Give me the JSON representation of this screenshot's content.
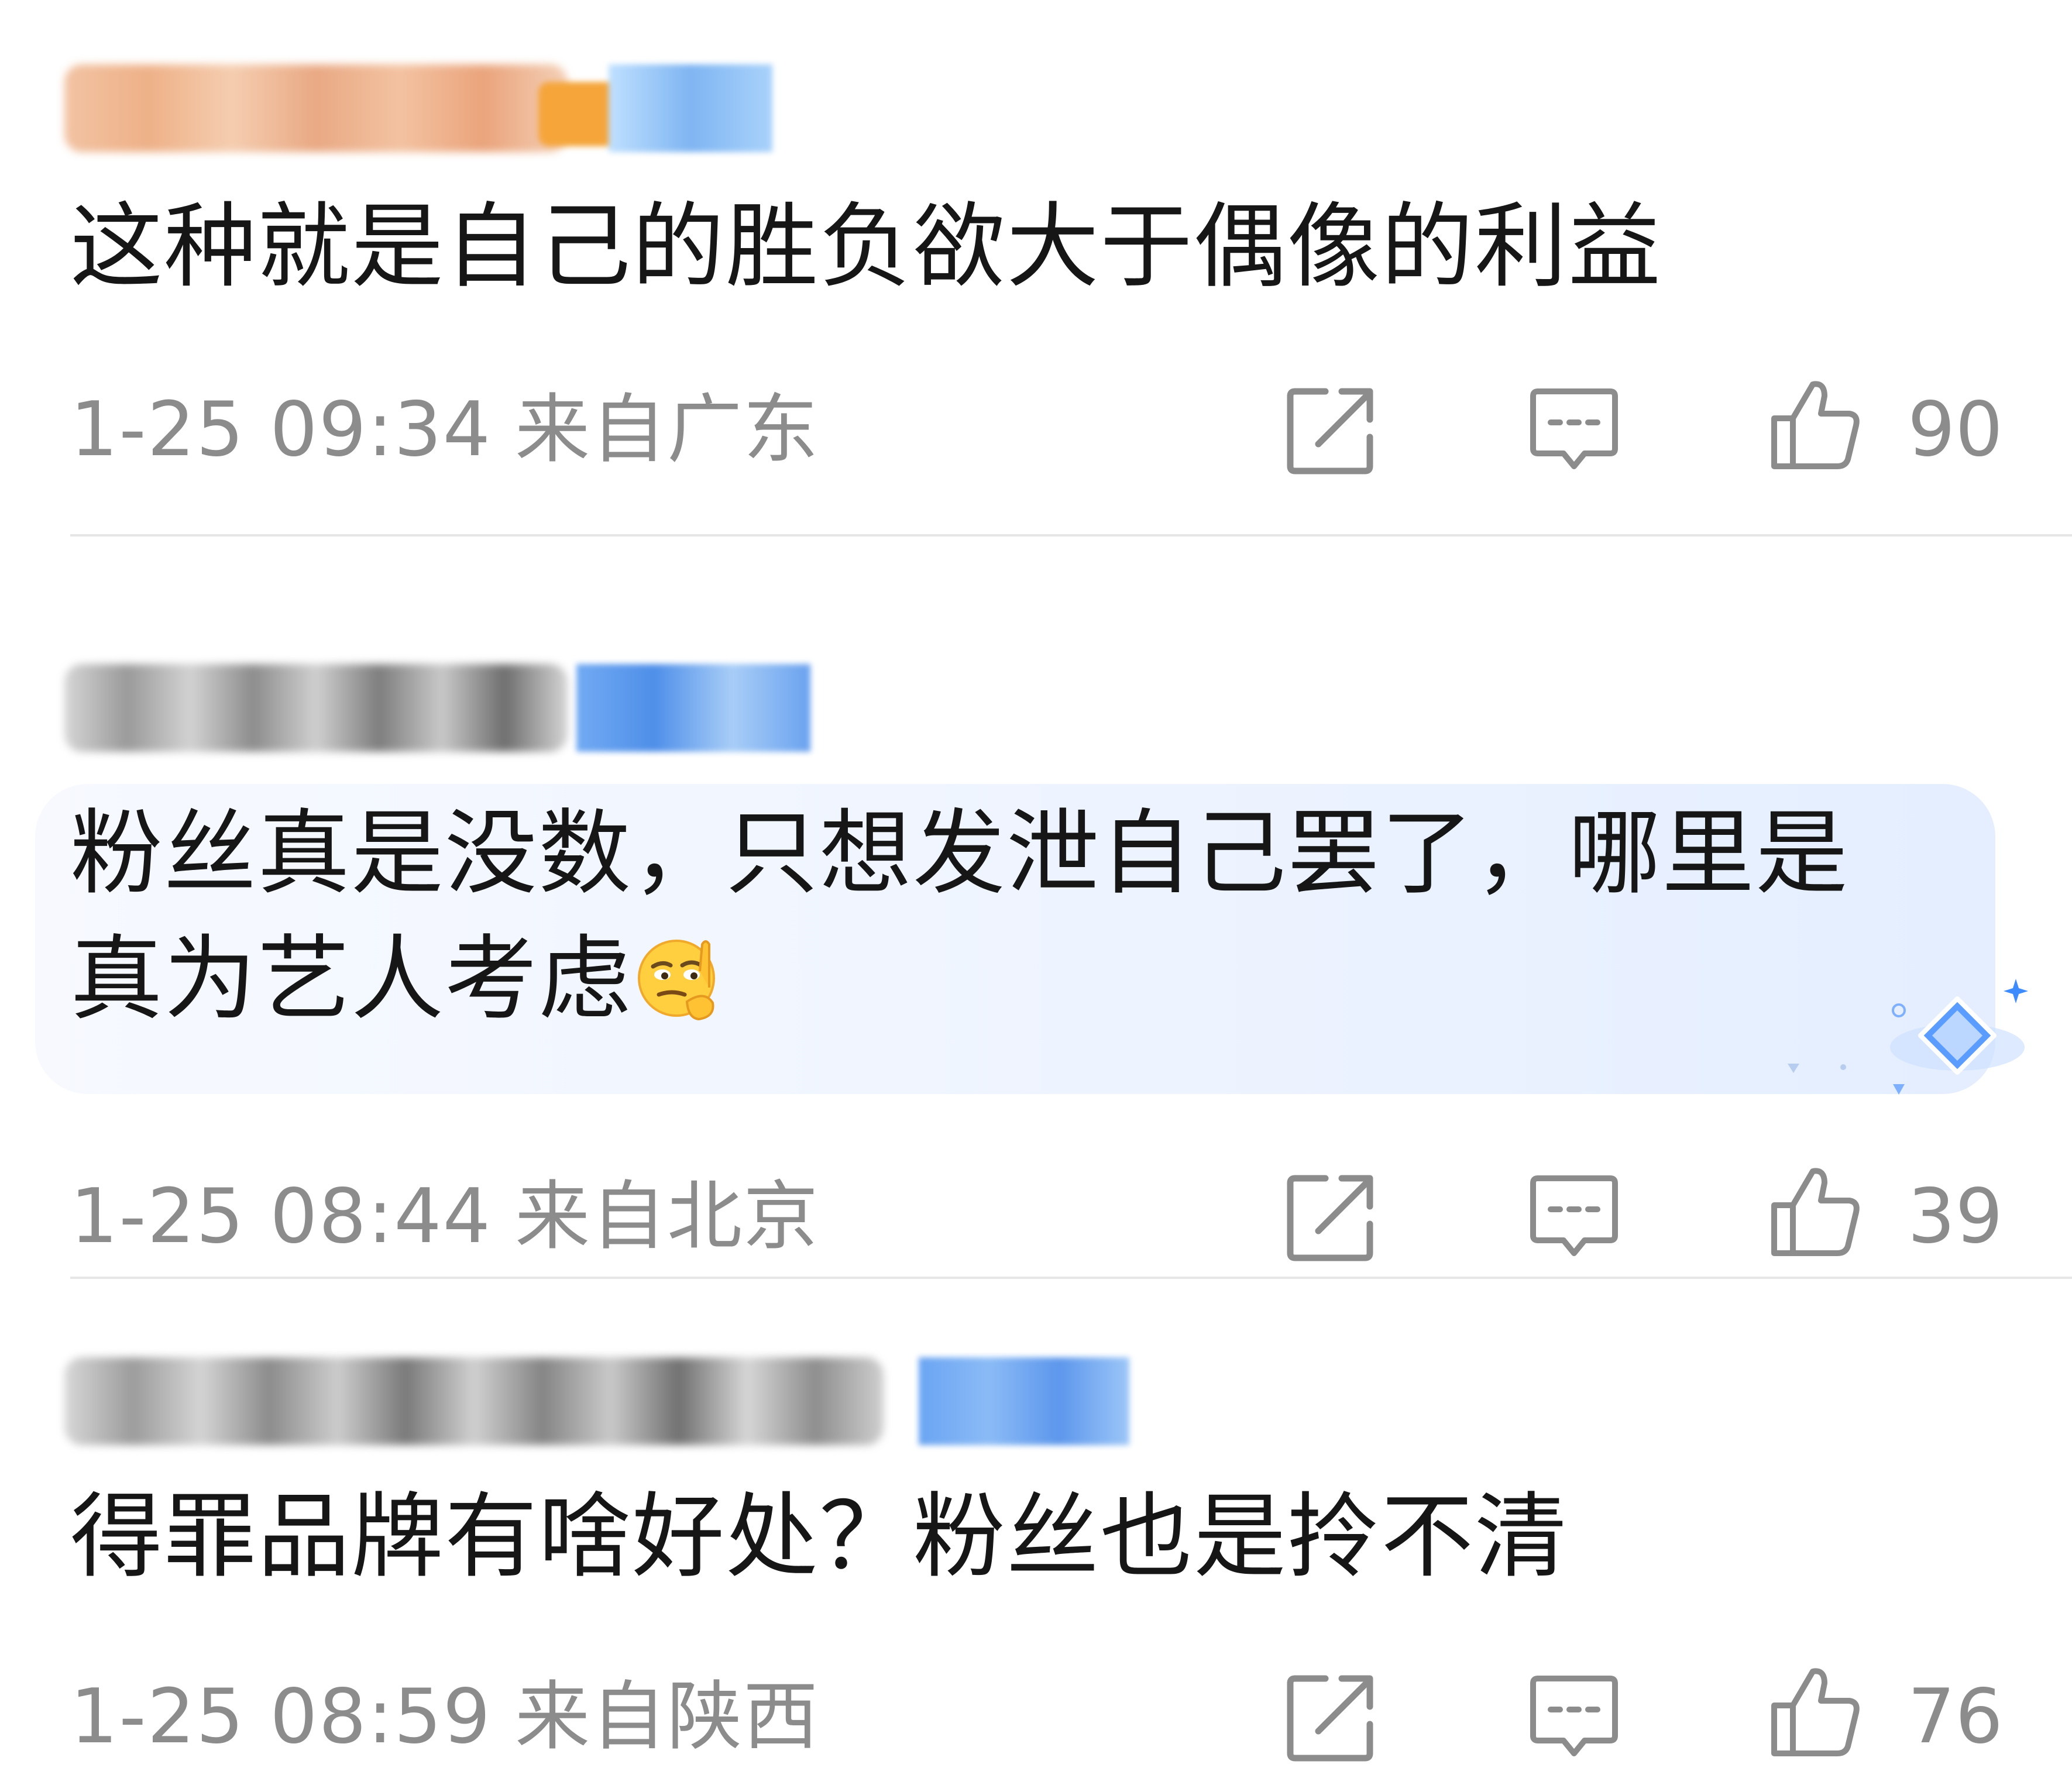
{
  "comments": [
    {
      "text": "这种就是自己的胜负欲大于偶像的利益",
      "date": "1-25 09:34",
      "location": "来自广东",
      "likes": "90",
      "highlighted": false
    },
    {
      "text": "粉丝真是没数，只想发泄自己罢了，哪里是真为艺人考虑",
      "emoji": "thinking-face-emoji",
      "date": "1-25 08:44",
      "location": "来自北京",
      "likes": "39",
      "highlighted": true
    },
    {
      "text": "得罪品牌有啥好处？粉丝也是拎不清",
      "date": "1-25 08:59",
      "location": "来自陕西",
      "likes": "76",
      "highlighted": false
    }
  ],
  "icons": {
    "share": "share-icon",
    "reply": "comment-icon",
    "like": "thumbs-up-icon",
    "badge": "diamond-badge-icon"
  },
  "colors": {
    "text": "#161616",
    "meta": "#8c8c8c",
    "divider": "#e6e6e6",
    "highlight": "#eef4ff",
    "badge_blue": "#3d8bff"
  }
}
